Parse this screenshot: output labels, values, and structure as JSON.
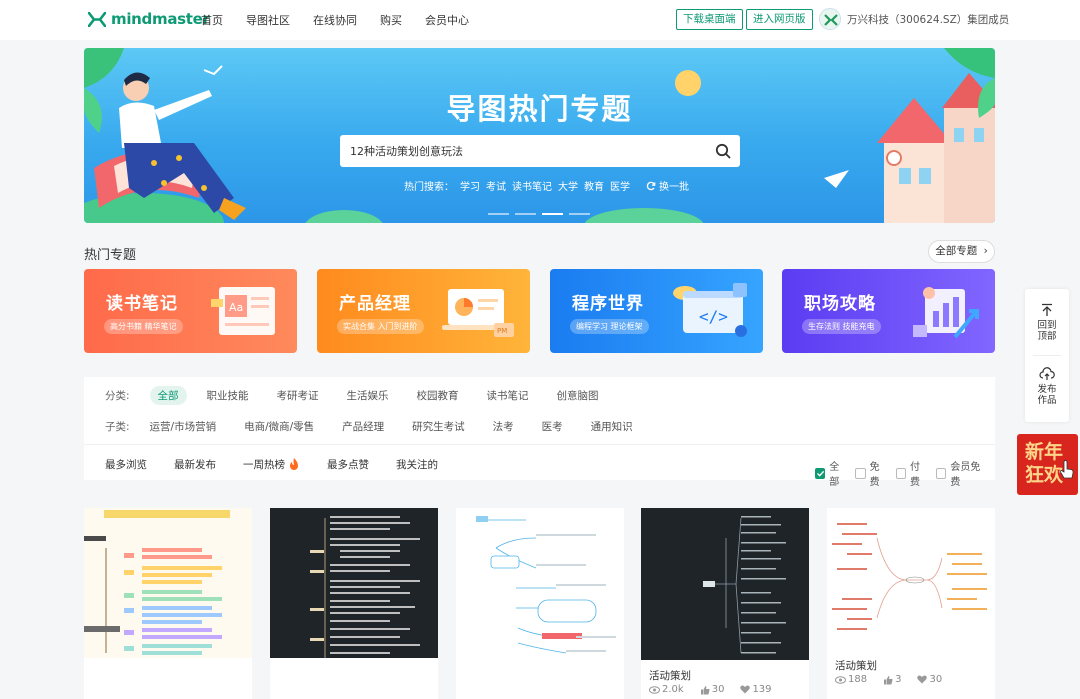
{
  "header": {
    "logo_text": "mindmaster",
    "nav": [
      "首页",
      "导图社区",
      "在线协同",
      "购买",
      "会员中心"
    ],
    "download_btn": "下载桌面端",
    "web_btn": "进入网页版",
    "user_name": "万兴科技（300624.SZ）集团成员"
  },
  "banner": {
    "title": "导图热门专题",
    "search_value": "12种活动策划创意玩法",
    "hot_label": "热门搜索：",
    "hot_terms": [
      "学习",
      "考试",
      "读书笔记",
      "大学",
      "教育",
      "医学"
    ],
    "refresh_label": "换一批"
  },
  "section": {
    "title": "热门专题",
    "all_label": "全部专题"
  },
  "cards": [
    {
      "title": "读书笔记",
      "sub": "高分书籍 精华笔记",
      "color": "#ff6a4a"
    },
    {
      "title": "产品经理",
      "sub": "实战合集 入门到进阶",
      "color": "#ff8a1e"
    },
    {
      "title": "程序世界",
      "sub": "编程学习 理论框架",
      "color": "#1a7cf0"
    },
    {
      "title": "职场攻略",
      "sub": "生存法则 技能充电",
      "color": "#5b3cf2"
    }
  ],
  "filter": {
    "category_label": "分类:",
    "categories": [
      "全部",
      "职业技能",
      "考研考证",
      "生活娱乐",
      "校园教育",
      "读书笔记",
      "创意脑图"
    ],
    "sub_label": "子类:",
    "subs": [
      "运营/市场营销",
      "电商/微商/零售",
      "产品经理",
      "研究生考试",
      "法考",
      "医考",
      "通用知识"
    ],
    "sorts": [
      "最多浏览",
      "最新发布",
      "一周热榜",
      "最多点赞",
      "我关注的"
    ],
    "checks": [
      {
        "label": "全部",
        "checked": true
      },
      {
        "label": "免费",
        "checked": false
      },
      {
        "label": "付费",
        "checked": false
      },
      {
        "label": "会员免费",
        "checked": false
      }
    ]
  },
  "side": {
    "top_label_1": "回到",
    "top_label_2": "顶部",
    "publish_label_1": "发布",
    "publish_label_2": "作品",
    "promo_text": "新年狂欢"
  },
  "works": [
    {
      "title": "",
      "views": "",
      "likes": "",
      "favs": ""
    },
    {
      "title": "",
      "views": "",
      "likes": "",
      "favs": ""
    },
    {
      "title": "",
      "views": "",
      "likes": "",
      "favs": ""
    },
    {
      "title": "活动策划",
      "views": "2.0k",
      "likes": "30",
      "favs": "139"
    },
    {
      "title": "活动策划",
      "views": "188",
      "likes": "3",
      "favs": "30"
    }
  ],
  "colors": {
    "brand": "#0d9a74",
    "promo": "#d8251d"
  }
}
